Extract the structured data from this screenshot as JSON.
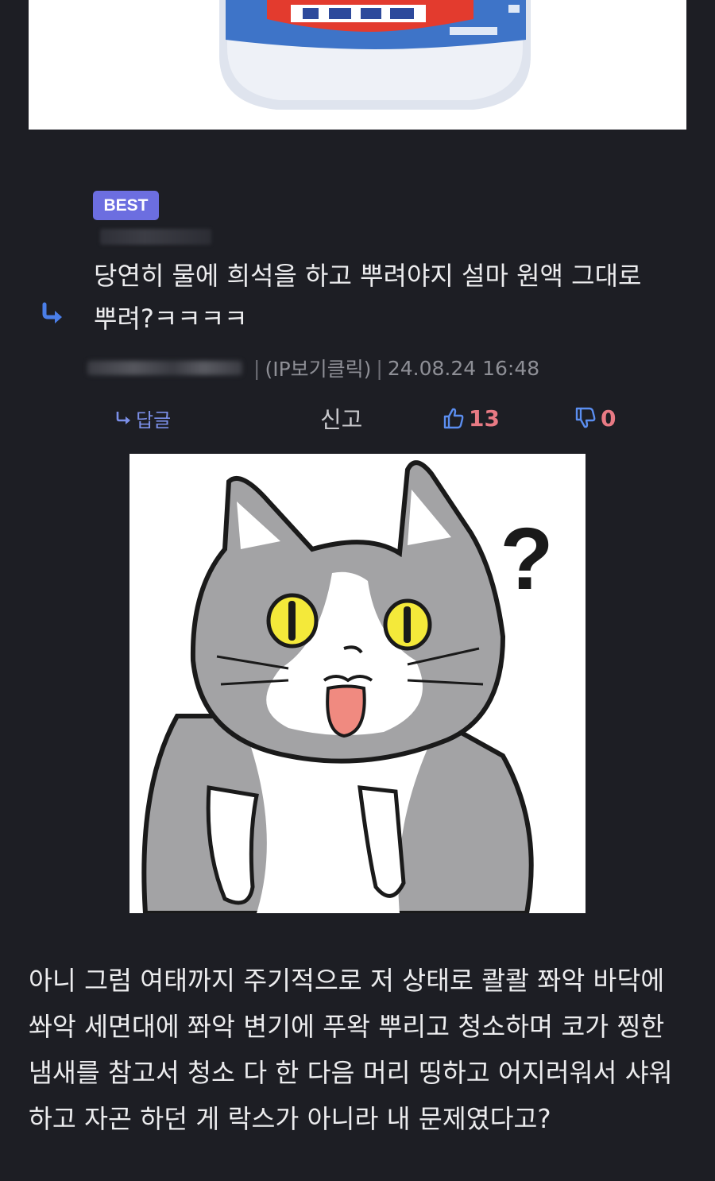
{
  "best_comment": {
    "badge": "BEST",
    "text": "당연히 물에 희석을 하고 뿌려야지 설마 원액 그대로 뿌려?ㅋㅋㅋㅋ",
    "ip_link": "(IP보기클릭)",
    "timestamp": "24.08.24 16:48"
  },
  "actions": {
    "reply_label": "답글",
    "report_label": "신고",
    "like_count": "13",
    "dislike_count": "0"
  },
  "cat_image": {
    "question_mark": "?"
  },
  "body": {
    "text": "아니 그럼 여태까지 주기적으로 저 상태로 콸콸 쫘악 바닥에 쏴악 세면대에 쫘악 변기에 푸왁 뿌리고 청소하며 코가 찡한 냄새를 참고서 청소 다 한 다음 머리 띵하고 어지러워서 샤워하고 자곤 하던 게 락스가 아니라 내 문제였다고?"
  },
  "colors": {
    "background": "#1d1e24",
    "badge": "#6c6ee0",
    "accent_blue": "#4a7ee8",
    "like_red": "#e87a84",
    "meta_gray": "#8e8f96"
  },
  "icons": [
    "reply-arrow-icon",
    "thumbs-up-icon",
    "thumbs-down-icon"
  ]
}
